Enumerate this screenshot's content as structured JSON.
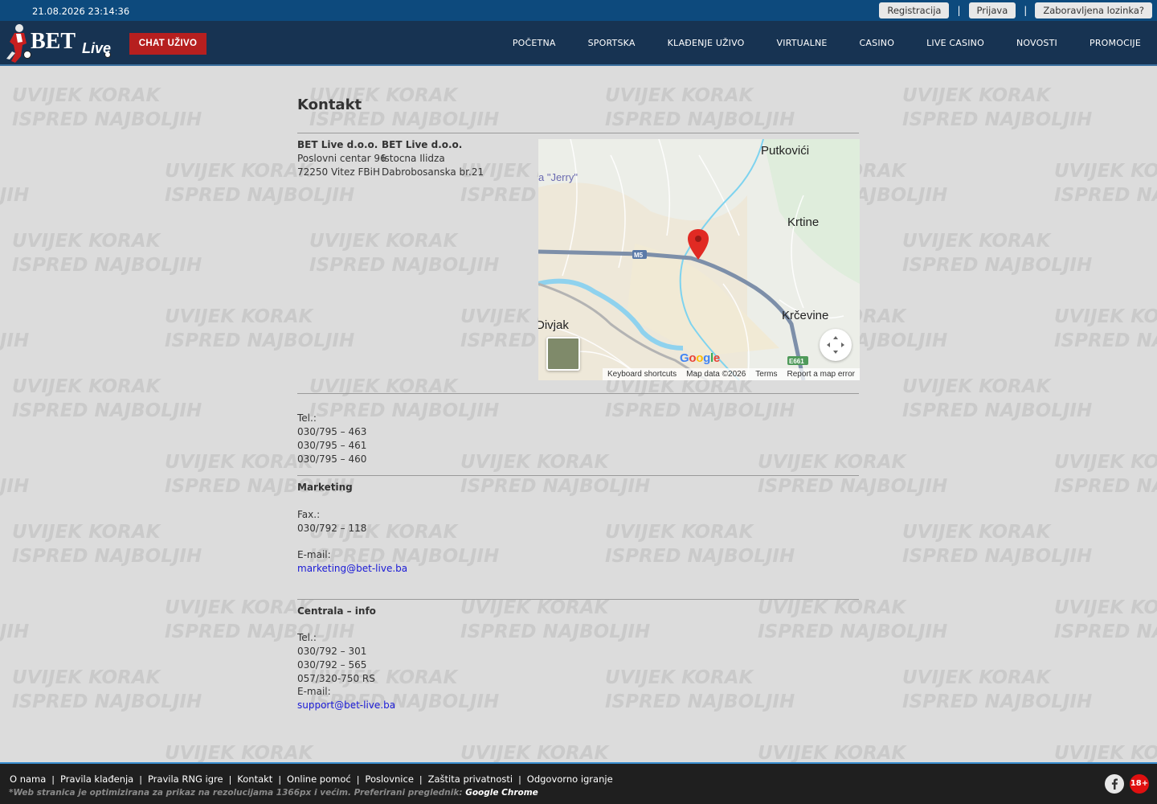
{
  "topbar": {
    "datetime": "21.08.2026 23:14:36",
    "register_label": "Registracija",
    "login_label": "Prijava",
    "forgot_label": "Zaboravljena lozinka?",
    "separator": "|"
  },
  "header": {
    "logo_text": "BET",
    "logo_sub": "Live",
    "chat_label": "CHAT UŽIVO",
    "nav": [
      "POČETNA",
      "SPORTSKA",
      "KLAĐENJE UŽIVO",
      "VIRTUALNE",
      "CASINO",
      "LIVE CASINO",
      "NOVOSTI",
      "PROMOCIJE"
    ]
  },
  "watermark": {
    "line1": "UVIJEK KORAK",
    "line2": "ISPRED NAJBOLJIH"
  },
  "main": {
    "title": "Kontakt",
    "address1": {
      "name": "BET Live d.o.o.",
      "street": "Poslovni centar 96",
      "city": "72250 Vitez FBiH"
    },
    "address2": {
      "name": "BET Live d.o.o.",
      "street": "Istocna Ilidza",
      "city": "Dabrobosanska br.21"
    },
    "tel_label": "Tel.:",
    "phones": [
      "030/795 – 463",
      "030/795 – 461",
      "030/795 – 460"
    ],
    "marketing": {
      "heading": "Marketing",
      "fax_label": "Fax.:",
      "fax": "030/792 – 118",
      "email_label": "E-mail:",
      "email": "marketing@bet-live.ba"
    },
    "central": {
      "heading": "Centrala – info",
      "tel_label": "Tel.:",
      "phones": [
        "030/792 – 301",
        "030/792 – 565",
        "057/320-750 RS"
      ],
      "email_label": "E-mail:",
      "email": "support@bet-live.ba"
    }
  },
  "map": {
    "labels": {
      "putkovici": "Putkovići",
      "krtine": "Krtine",
      "krcevine": "Krčevine",
      "divjak": "Divjak",
      "jerry": "a \"Jerry\"",
      "road_m5": "M5",
      "road_e661": "E661"
    },
    "google": "Google",
    "footer": {
      "shortcuts": "Keyboard shortcuts",
      "mapdata": "Map data ©2026",
      "terms": "Terms",
      "report": "Report a map error"
    }
  },
  "footer": {
    "links": [
      "O nama",
      "Pravila klađenja",
      "Pravila RNG igre",
      "Kontakt",
      "Online pomoć",
      "Poslovnice",
      "Zaštita privatnosti",
      "Odgovorno igranje"
    ],
    "note": "*Web stranica je optimizirana za prikaz na rezolucijama 1366px i većim. Preferirani preglednik:",
    "browser": "Google Chrome",
    "age": "18+"
  }
}
